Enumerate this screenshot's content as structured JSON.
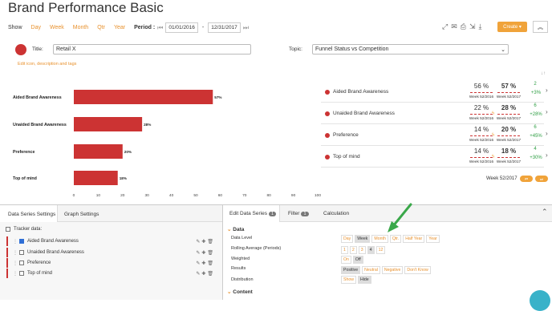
{
  "page": {
    "title": "Brand Performance Basic"
  },
  "toolbar": {
    "show_label": "Show",
    "periods": [
      "Day",
      "Week",
      "Month",
      "Qtr",
      "Year"
    ],
    "period_label": "Period :",
    "date_from": "01/01/2016",
    "date_sep": "-",
    "date_to": "12/31/2017",
    "create_label": "Create ▾",
    "collapse_label": "︽"
  },
  "editor": {
    "title_label": "Title:",
    "title_value": "Retail X",
    "topic_label": "Topic:",
    "topic_value": "Funnel Status vs Competition",
    "edit_link": "Edit icon, description and tags"
  },
  "chart_data": {
    "type": "bar",
    "orientation": "horizontal",
    "categories": [
      "Aided Brand Awareness",
      "Unaided Brand Awareness",
      "Preference",
      "Top of mind"
    ],
    "values": [
      57,
      28,
      20,
      18
    ],
    "data_labels": [
      "57%",
      "28%",
      "20%",
      "18%"
    ],
    "xlim": [
      0,
      100
    ],
    "xticks": [
      "0",
      "10",
      "20",
      "30",
      "40",
      "50",
      "60",
      "70",
      "80",
      "90",
      "100"
    ],
    "bar_color": "#cc3333"
  },
  "metrics": {
    "rows": [
      {
        "name": "Aided Brand Awareness",
        "v1": "56 %",
        "w1": "Week 52/2016",
        "v2": "57 %",
        "w2": "Week 52/2017",
        "ch1": "2",
        "ch2": "+3%"
      },
      {
        "name": "Unaided Brand Awareness",
        "v1": "22 %",
        "w1": "Week 52/2016",
        "v2": "28 %",
        "w2": "Week 52/2017",
        "ch1": "6",
        "ch2": "+28%"
      },
      {
        "name": "Preference",
        "v1": "14 %",
        "w1": "Week 52/2016",
        "v2": "20 %",
        "w2": "Week 52/2017",
        "ch1": "6",
        "ch2": "+45%"
      },
      {
        "name": "Top of mind",
        "v1": "14 %",
        "w1": "Week 52/2016",
        "v2": "18 %",
        "w2": "Week 52/2017",
        "ch1": "4",
        "ch2": "+30%"
      }
    ],
    "week_label": "Week 52/2017"
  },
  "left_tabs": {
    "tab1": "Data Series Settings",
    "tab2": "Graph Settings",
    "tracker_label": "Tracker data:",
    "series": [
      "Aided Brand Awareness",
      "Unaided Brand Awareness",
      "Preference",
      "Top of mind"
    ]
  },
  "right_tabs": {
    "tab1": "Edit Data Series",
    "tab1_count": "1",
    "tab2": "Filter",
    "tab2_count": "1",
    "tab3": "Calculation"
  },
  "data_section": {
    "heading": "Data",
    "data_level_label": "Data Level",
    "data_levels": [
      "Day",
      "Week",
      "Month",
      "Qtr.",
      "Half Year",
      "Year"
    ],
    "rolling_label": "Rolling Average (Periods)",
    "rolling": [
      "1",
      "2",
      "3",
      "4",
      "12"
    ],
    "weighted_label": "Weighted",
    "weighted": [
      "On",
      "Off"
    ],
    "results_label": "Results",
    "results": [
      "Positive",
      "Neutral",
      "Negative",
      "Don't Know"
    ],
    "distribution_label": "Distribution",
    "distribution": [
      "Show",
      "Hide"
    ],
    "content_heading": "Content"
  }
}
